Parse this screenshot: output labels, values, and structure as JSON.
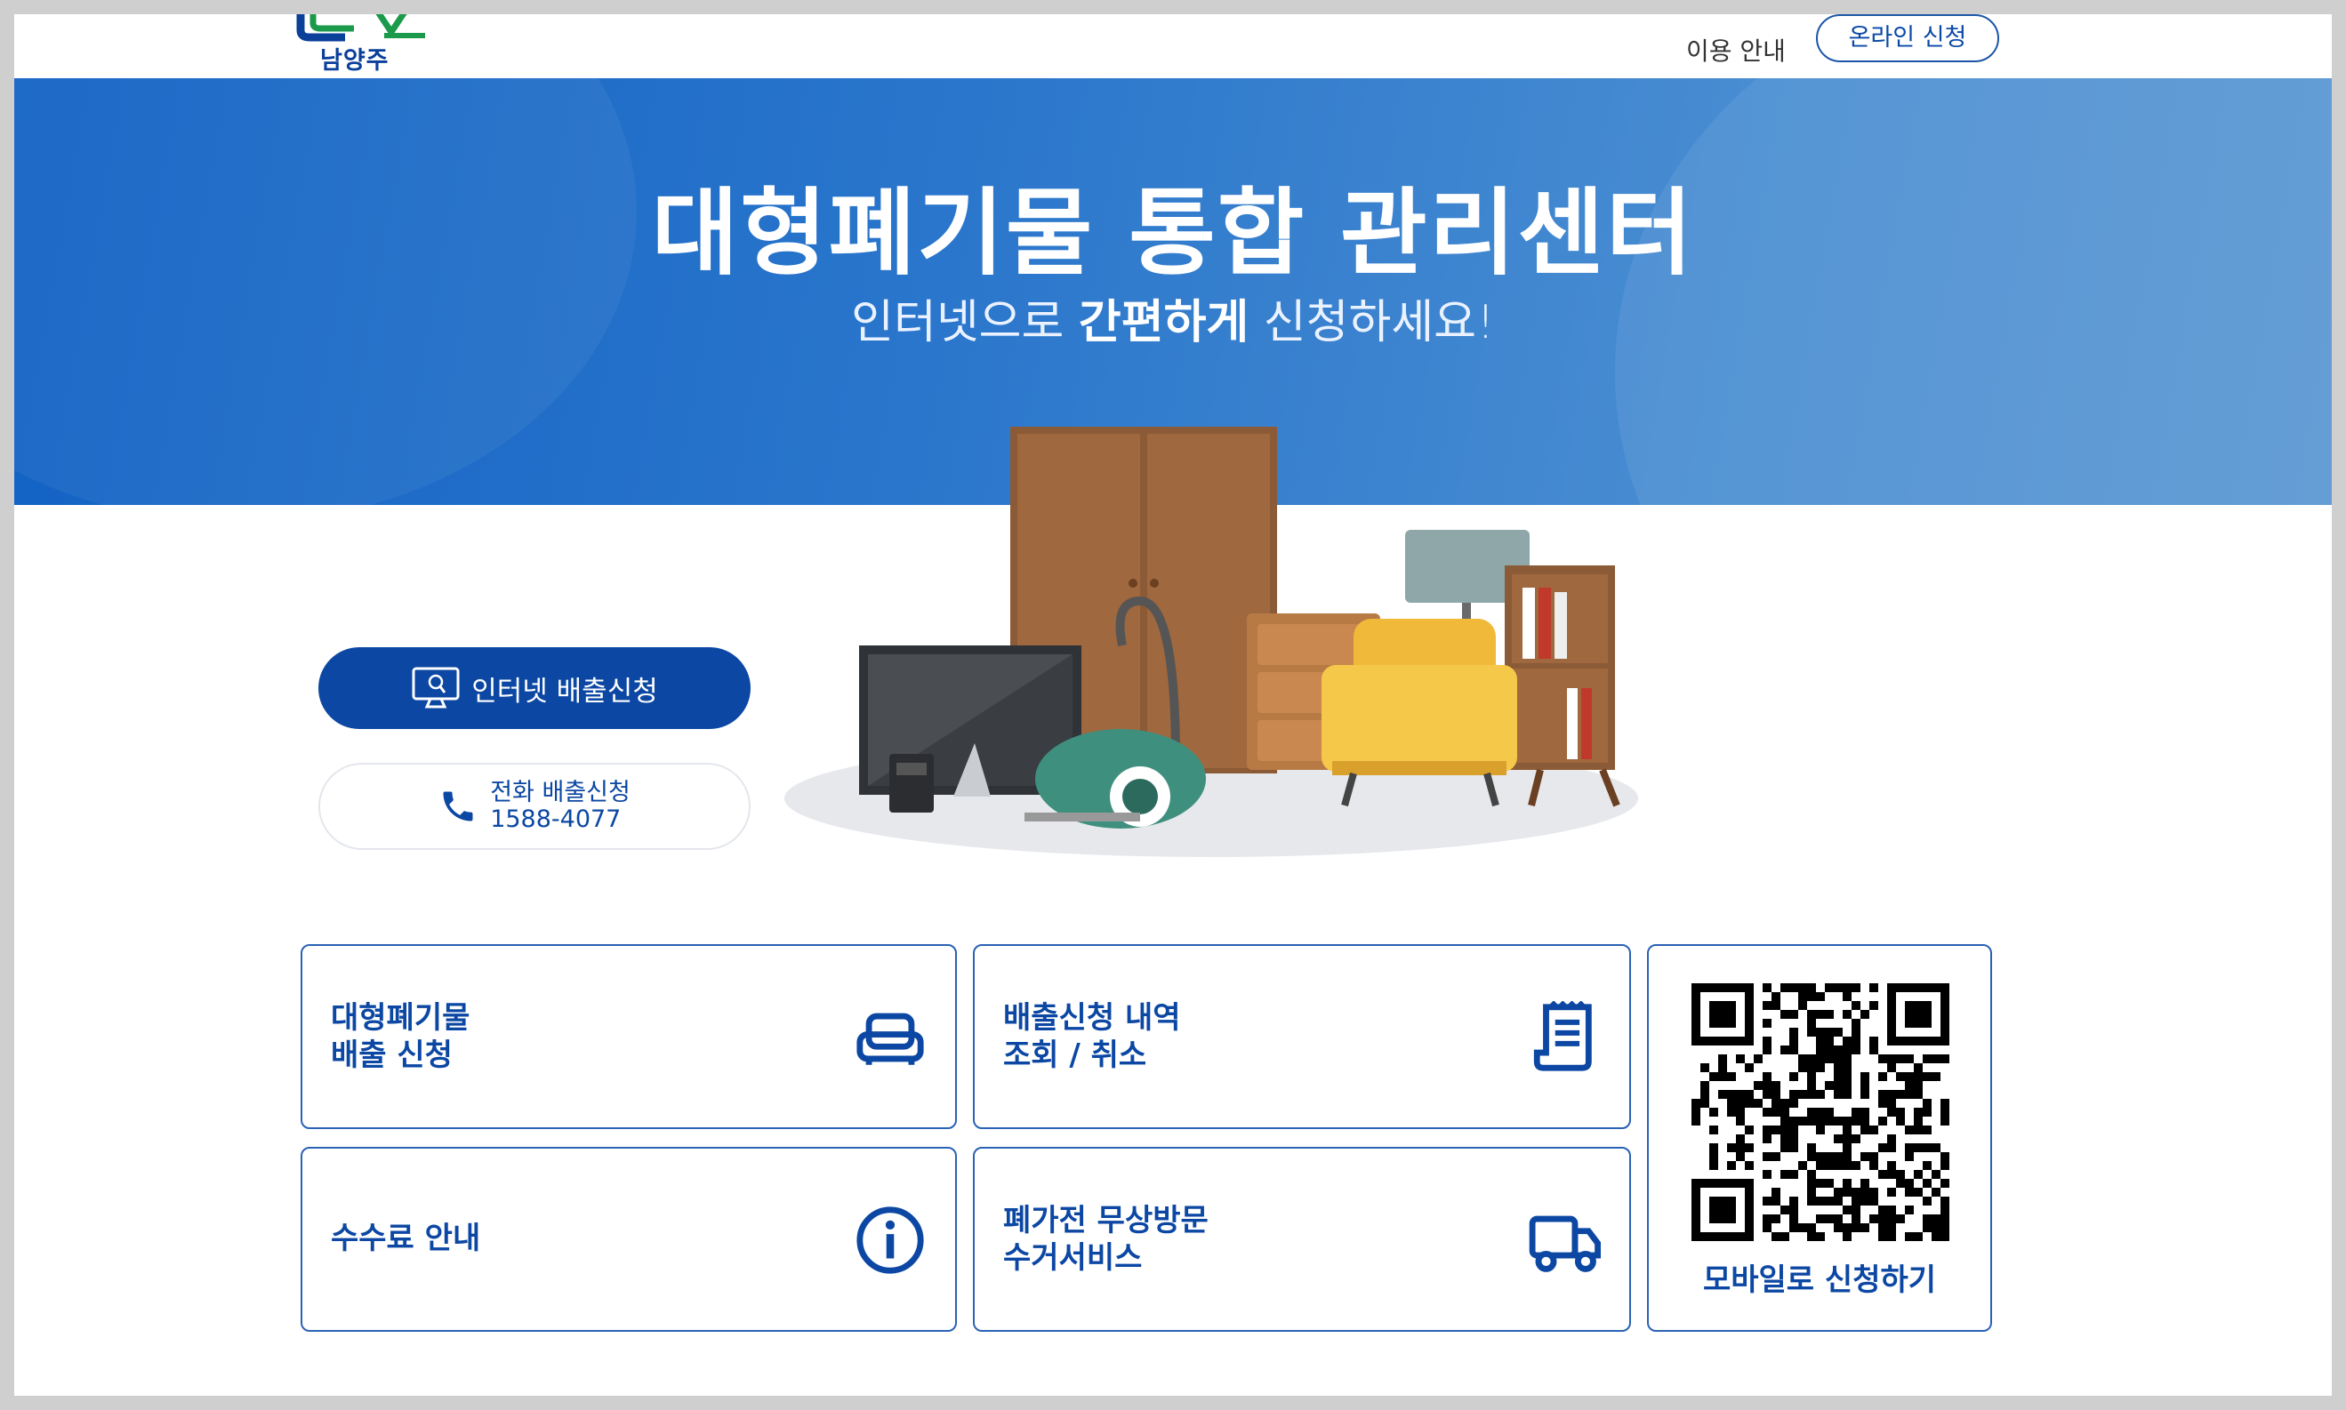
{
  "header": {
    "logo_text": "남양주",
    "nav_guide": "이용 안내",
    "nav_apply": "온라인 신청"
  },
  "hero": {
    "title": "대형폐기물 통합 관리센터",
    "sub_prefix": "인터넷으로 ",
    "sub_bold": "간편하게",
    "sub_suffix": " 신청하세요!"
  },
  "actions": {
    "internet_label": "인터넷 배출신청",
    "phone_label": "전화 배출신청",
    "phone_number": "1588-4077"
  },
  "cards": {
    "apply": {
      "line1": "대형폐기물",
      "line2": "배출 신청"
    },
    "history": {
      "line1": "배출신청 내역",
      "line2": "조회 / 취소"
    },
    "fee": {
      "line1": "수수료 안내"
    },
    "appliance": {
      "line1": "폐가전 무상방문",
      "line2": "수거서비스"
    },
    "mobile": {
      "label": "모바일로 신청하기"
    }
  },
  "colors": {
    "brand": "#0b47a3",
    "hero_blue": "#1262c4"
  },
  "icons": [
    "sofa-icon",
    "receipt-icon",
    "info-icon",
    "truck-icon",
    "monitor-icon",
    "phone-icon",
    "qr-code"
  ]
}
